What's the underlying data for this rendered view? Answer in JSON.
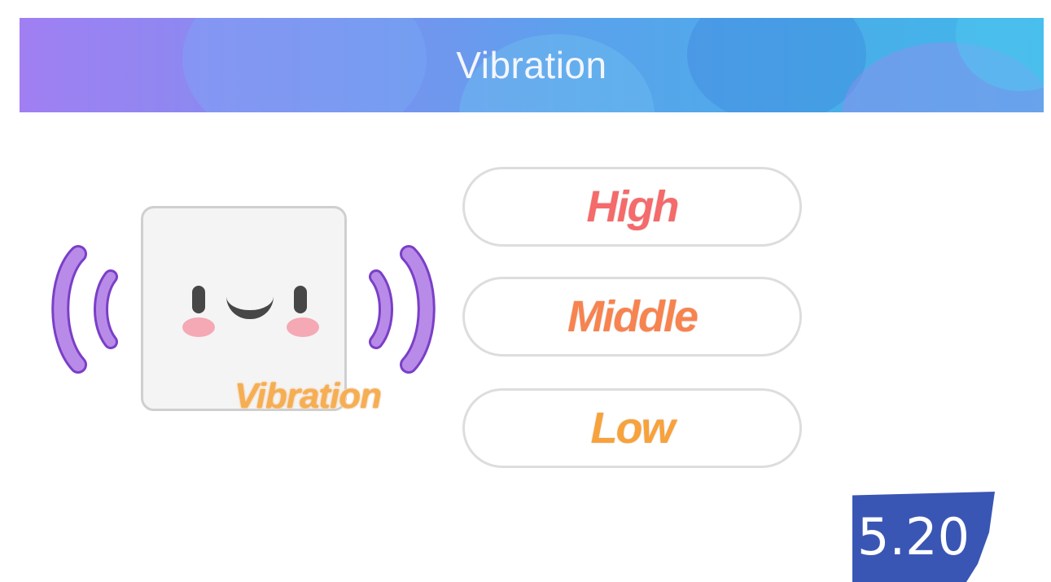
{
  "header": {
    "title": "Vibration",
    "gradient_colors": [
      "#a07ff2",
      "#5aa2ec",
      "#43b6ea"
    ]
  },
  "device": {
    "icon": "vibrating-smiley-device-icon",
    "label": "Vibration",
    "wave_color": "#b98be8"
  },
  "levels": [
    {
      "label": "High",
      "color": "#f56a6a"
    },
    {
      "label": "Middle",
      "color": "#f7834f"
    },
    {
      "label": "Low",
      "color": "#f7a23c"
    }
  ],
  "version_badge": {
    "text": "5.20",
    "color": "#3a56b4"
  }
}
